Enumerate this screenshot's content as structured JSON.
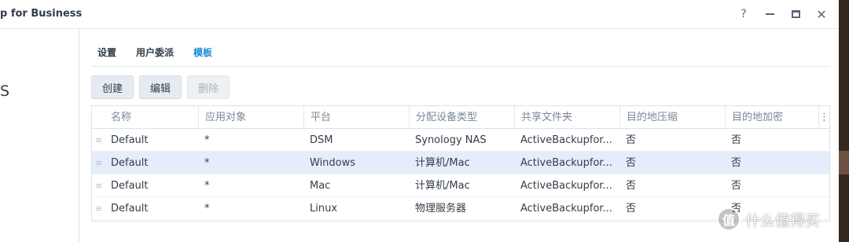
{
  "window": {
    "title": "p for Business",
    "controls": {
      "help": "?",
      "close": "✕"
    }
  },
  "left_panel": {
    "partial_text": "S"
  },
  "tabs": [
    {
      "label": "设置",
      "active": false
    },
    {
      "label": "用户委派",
      "active": false
    },
    {
      "label": "模板",
      "active": true
    }
  ],
  "toolbar": {
    "create_label": "创建",
    "edit_label": "编辑",
    "delete_label": "删除",
    "delete_disabled": true
  },
  "table": {
    "columns": [
      "名称",
      "应用对象",
      "平台",
      "分配设备类型",
      "共享文件夹",
      "目的地压缩",
      "目的地加密"
    ],
    "column_menu_glyph": "⋮",
    "drag_glyph": "≡",
    "rows": [
      {
        "name": "Default",
        "target": "*",
        "platform": "DSM",
        "device_type": "Synology NAS",
        "shared_folder": "ActiveBackupfor...",
        "compression": "否",
        "encryption": "否",
        "selected": false
      },
      {
        "name": "Default",
        "target": "*",
        "platform": "Windows",
        "device_type": "计算机/Mac",
        "shared_folder": "ActiveBackupfor...",
        "compression": "否",
        "encryption": "否",
        "selected": true
      },
      {
        "name": "Default",
        "target": "*",
        "platform": "Mac",
        "device_type": "计算机/Mac",
        "shared_folder": "ActiveBackupfor...",
        "compression": "否",
        "encryption": "否",
        "selected": false
      },
      {
        "name": "Default",
        "target": "*",
        "platform": "Linux",
        "device_type": "物理服务器",
        "shared_folder": "ActiveBackupfor...",
        "compression": "否",
        "encryption": "否",
        "selected": false
      }
    ]
  },
  "watermark": {
    "logo_char": "值",
    "text": "什么值得买"
  },
  "colors": {
    "accent": "#1a8ad6",
    "selected_row": "#e4eefb",
    "button_bg": "#e5ebf1"
  }
}
